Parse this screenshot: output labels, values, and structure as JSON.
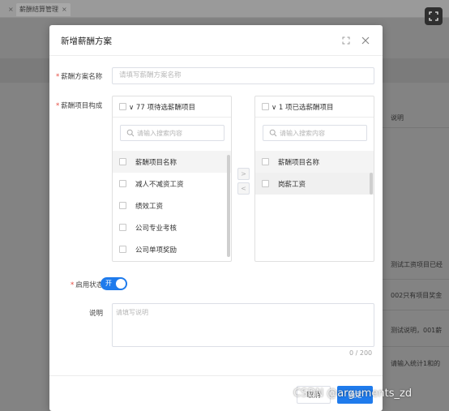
{
  "background": {
    "tabs": [
      {
        "label": "",
        "close": "×"
      },
      {
        "label": "薪酬结算管理",
        "close": "×"
      }
    ],
    "column_header": "说明",
    "rows": [
      "测试工资项目已经",
      "002只有项目奖金",
      "测试说明，001薪",
      "请输入统计1和的"
    ]
  },
  "modal": {
    "title": "新增薪酬方案",
    "name_label": "薪酬方案名称",
    "name_placeholder": "请填写薪酬方案名称",
    "items_label": "薪酬项目构成",
    "left_panel": {
      "header": "∨ 77 项待选薪酬项目",
      "search_placeholder": "请输入搜索内容",
      "items": [
        "薪酬项目名称",
        "减人不减资工资",
        "绩效工资",
        "公司专业考核",
        "公司单项奖励"
      ]
    },
    "right_panel": {
      "header": "∨ 1 项已选薪酬项目",
      "search_placeholder": "请输入搜索内容",
      "items": [
        "薪酬项目名称",
        "岗薪工资"
      ]
    },
    "move_right": ">",
    "move_left": "<",
    "status_label": "启用状态",
    "switch_on": "开",
    "desc_label": "说明",
    "desc_placeholder": "请填写说明",
    "counter": "0 / 200",
    "cancel": "取消",
    "ok": "确定"
  },
  "watermark": "CSDN @arguments_zd",
  "colors": {
    "primary": "#1f7bec",
    "required": "#e5483d"
  }
}
